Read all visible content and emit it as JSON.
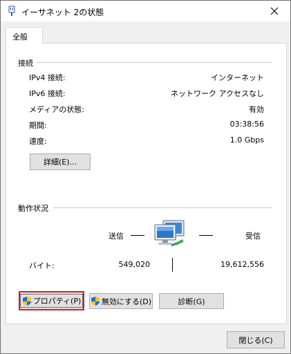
{
  "window": {
    "title": "イーサネット 2の状態",
    "close_symbol": "✕"
  },
  "tabs": [
    {
      "label": "全般"
    }
  ],
  "connection": {
    "heading": "接続",
    "rows": [
      {
        "label": "IPv4 接続:",
        "value": "インターネット"
      },
      {
        "label": "IPv6 接続:",
        "value": "ネットワーク アクセスなし"
      },
      {
        "label": "メディアの状態:",
        "value": "有効"
      },
      {
        "label": "期間:",
        "value": "03:38:56"
      },
      {
        "label": "速度:",
        "value": "1.0 Gbps"
      }
    ],
    "details_button": "詳細(E)..."
  },
  "activity": {
    "heading": "動作状況",
    "sent_label": "送信",
    "received_label": "受信",
    "bytes_label": "バイト:",
    "bytes_sent": "549,020",
    "bytes_received": "19,612,556"
  },
  "actions": {
    "properties_button": "プロパティ(P)",
    "disable_button": "無効にする(D)",
    "diagnose_button": "診断(G)"
  },
  "footer": {
    "close_button": "閉じる(C)"
  },
  "colors": {
    "focus_highlight": "#e01b24",
    "panel_background": "#ffffff",
    "window_background": "#f0f0f0"
  }
}
